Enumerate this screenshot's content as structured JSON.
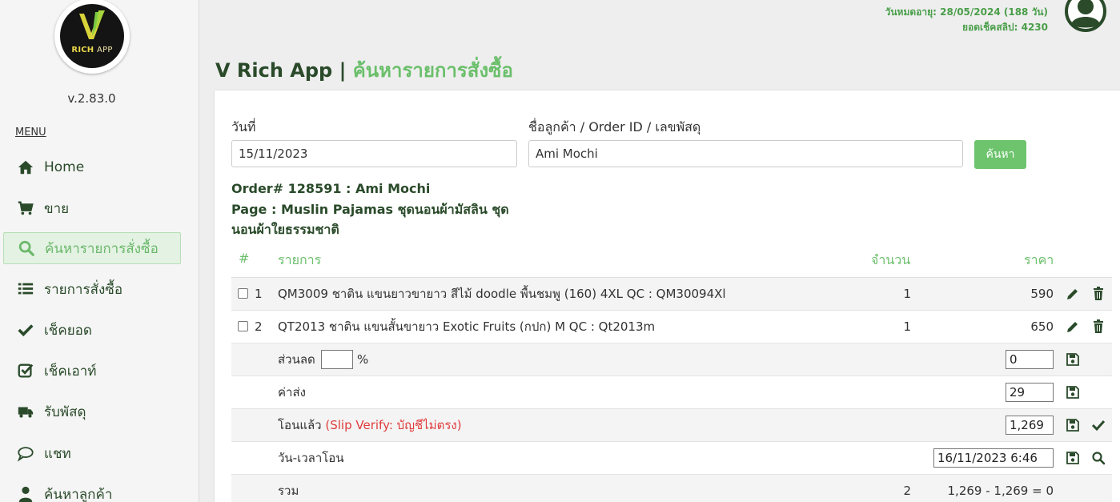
{
  "app": {
    "logo_text_a": "RICH",
    "logo_text_b": "APP",
    "version": "v.2.83.0",
    "menu_title": "MENU"
  },
  "nav": [
    {
      "label": "Home",
      "icon": "home-icon"
    },
    {
      "label": "ขาย",
      "icon": "cart-icon"
    },
    {
      "label": "ค้นหารายการสั่งซื้อ",
      "icon": "search-icon",
      "active": true
    },
    {
      "label": "รายการสั่งซื้อ",
      "icon": "list-icon"
    },
    {
      "label": "เช็คยอด",
      "icon": "check-icon"
    },
    {
      "label": "เช็คเอาท์",
      "icon": "check-square-icon"
    },
    {
      "label": "รับพัสดุ",
      "icon": "truck-icon"
    },
    {
      "label": "แชท",
      "icon": "chat-icon"
    },
    {
      "label": "ค้นหาลูกค้า",
      "icon": "user-icon"
    }
  ],
  "header": {
    "title_main": "V Rich App | ",
    "title_sub": "ค้นหารายการสั่งซื้อ",
    "expiry": "วันหมดอายุ: 28/05/2024 (188 วัน)",
    "slip_balance": "ยอดเช็คสลิป: 4230"
  },
  "search": {
    "date_label": "วันที่",
    "date_value": "15/11/2023",
    "query_label": "ชื่อลูกค้า / Order ID / เลขพัสดุ",
    "query_value": "Ami Mochi",
    "button_label": "ค้นหา"
  },
  "order": {
    "order_line": "Order# 128591 : Ami Mochi",
    "page_line": "Page : Muslin Pajamas ชุดนอนผ้ามัสลิน ชุดนอนผ้าใยธรรมชาติ",
    "columns": {
      "index": "#",
      "item": "รายการ",
      "qty": "จำนวน",
      "price": "ราคา"
    },
    "items": [
      {
        "index": "1",
        "name": "QM3009 ชาติน แขนยาวขายาว สีไม้ doodle พื้นชมพู (160) 4XL QC : QM30094Xl",
        "qty": "1",
        "price": "590"
      },
      {
        "index": "2",
        "name": "QT2013 ชาติน แขนสั้นขายาว Exotic Fruits (กปก) M QC : Qt2013m",
        "qty": "1",
        "price": "650"
      }
    ],
    "discount": {
      "label": "ส่วนลด",
      "percent_value": "",
      "percent_sign": "%",
      "amount": "0"
    },
    "shipping": {
      "label": "ค่าส่ง",
      "amount": "29"
    },
    "transferred": {
      "label": "โอนแล้ว",
      "warning": "(Slip Verify: บัญชีไม่ตรง)",
      "amount": "1,269"
    },
    "transfer_time": {
      "label": "วัน-เวลาโอน",
      "value": "16/11/2023 6:46"
    },
    "total": {
      "label": "รวม",
      "qty": "2",
      "summary": "1,269 - 1,269 = 0"
    }
  },
  "colors": {
    "accent": "#6bbf6b",
    "dark_green": "#2a4a2a",
    "button": "#6dc46d",
    "warning": "#e03c3c"
  }
}
